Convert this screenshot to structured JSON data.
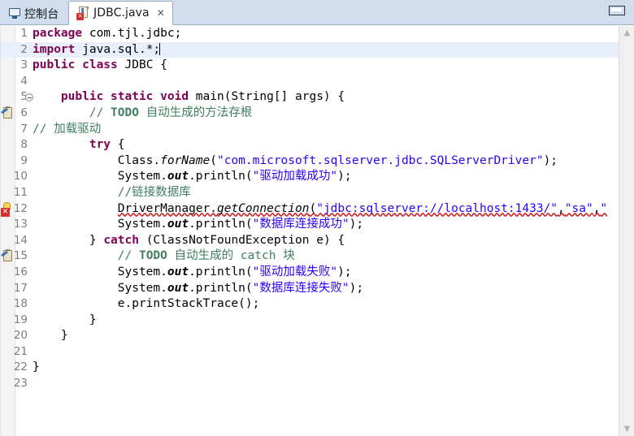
{
  "window": {
    "minimize_label": "Minimize"
  },
  "tabs": [
    {
      "label": "控制台",
      "icon": "console-icon",
      "active": false,
      "closable": false
    },
    {
      "label": "JDBC.java",
      "icon": "java-file-error-icon",
      "active": true,
      "closable": true,
      "close_glyph": "✕"
    }
  ],
  "editor": {
    "language": "java",
    "current_line": 2,
    "total_lines": 23,
    "colors": {
      "keyword": "#7f0055",
      "string": "#2a00ff",
      "comment": "#3f7f5f",
      "error_underline": "#d10b0b",
      "current_line_bg": "#e8f0fb",
      "gutter_bg": "#f4f4f4",
      "tabbar_bg": "#cfdded",
      "background": "#ffffff"
    },
    "lines": [
      {
        "n": "1",
        "marker": "none",
        "fold": false,
        "html": "<span class=\"kw\">package</span> <span class=\"plain\">com.tjl.jdbc;</span>",
        "plain": "package com.tjl.jdbc;"
      },
      {
        "n": "2",
        "marker": "change",
        "fold": false,
        "html": "<span class=\"kw\">import</span> <span class=\"plain\">java.sql.*;</span><span class=\"caret\"></span>",
        "plain": "import java.sql.*;"
      },
      {
        "n": "3",
        "marker": "none",
        "fold": false,
        "html": "<span class=\"kw\">public class</span> <span class=\"plain\">JDBC {</span>",
        "plain": "public class JDBC {"
      },
      {
        "n": "4",
        "marker": "none",
        "fold": false,
        "html": "",
        "plain": ""
      },
      {
        "n": "5",
        "marker": "none",
        "fold": true,
        "html": "<span class=\"plain\">    </span><span class=\"kw\">public static void</span> <span class=\"plain\">main(String[] args) {</span>",
        "plain": "    public static void main(String[] args) {"
      },
      {
        "n": "6",
        "marker": "todo",
        "fold": false,
        "html": "<span class=\"plain\">        </span><span class=\"cmt\">// </span><span class=\"todo\">TODO</span><span class=\"cmt\"> 自动生成的方法存根</span>",
        "plain": "        // TODO 自动生成的方法存根"
      },
      {
        "n": "7",
        "marker": "none",
        "fold": false,
        "html": "<span class=\"cmt\">// 加载驱动</span>",
        "plain": "// 加载驱动"
      },
      {
        "n": "8",
        "marker": "none",
        "fold": false,
        "html": "<span class=\"plain\">        </span><span class=\"kw\">try</span> <span class=\"plain\">{</span>",
        "plain": "        try {"
      },
      {
        "n": "9",
        "marker": "none",
        "fold": false,
        "html": "<span class=\"plain\">            Class.</span><span class=\"fld\">forName</span><span class=\"plain\">(</span><span class=\"str\">\"com.microsoft.sqlserver.jdbc.SQLServerDriver\"</span><span class=\"plain\">);</span>",
        "plain": "            Class.forName(\"com.microsoft.sqlserver.jdbc.SQLServerDriver\");"
      },
      {
        "n": "10",
        "marker": "none",
        "fold": false,
        "html": "<span class=\"plain\">            System.</span><span class=\"stat\">out</span><span class=\"plain\">.println(</span><span class=\"str\">\"驱动加载成功\"</span><span class=\"plain\">);</span>",
        "plain": "            System.out.println(\"驱动加载成功\");"
      },
      {
        "n": "11",
        "marker": "none",
        "fold": false,
        "html": "<span class=\"plain\">            </span><span class=\"cmt\">//链接数据库</span>",
        "plain": "            //链接数据库"
      },
      {
        "n": "12",
        "marker": "error",
        "fold": false,
        "html": "<span class=\"plain\">            </span><span class=\"err-underline\"><span class=\"plain\">DriverManager.</span><span class=\"fld\">getConnection</span><span class=\"plain\">(</span><span class=\"str\">\"jdbc:sqlserver://localhost:1433/\"</span><span class=\"plain\">,</span><span class=\"str\">\"sa\"</span><span class=\"plain\">,</span><span class=\"str\">\"</span></span>",
        "plain": "            DriverManager.getConnection(\"jdbc:sqlserver://localhost:1433/\",\"sa\",\""
      },
      {
        "n": "13",
        "marker": "none",
        "fold": false,
        "html": "<span class=\"plain\">            System.</span><span class=\"stat\">out</span><span class=\"plain\">.println(</span><span class=\"str\">\"数据库连接成功\"</span><span class=\"plain\">);</span>",
        "plain": "            System.out.println(\"数据库连接成功\");"
      },
      {
        "n": "14",
        "marker": "none",
        "fold": false,
        "html": "<span class=\"plain\">        } </span><span class=\"kw\">catch</span> <span class=\"plain\">(ClassNotFoundException e) {</span>",
        "plain": "        } catch (ClassNotFoundException e) {"
      },
      {
        "n": "15",
        "marker": "todo",
        "fold": false,
        "html": "<span class=\"plain\">            </span><span class=\"cmt\">// </span><span class=\"todo\">TODO</span><span class=\"cmt\"> 自动生成的 catch 块</span>",
        "plain": "            // TODO 自动生成的 catch 块"
      },
      {
        "n": "16",
        "marker": "none",
        "fold": false,
        "html": "<span class=\"plain\">            System.</span><span class=\"stat\">out</span><span class=\"plain\">.println(</span><span class=\"str\">\"驱动加载失败\"</span><span class=\"plain\">);</span>",
        "plain": "            System.out.println(\"驱动加载失败\");"
      },
      {
        "n": "17",
        "marker": "none",
        "fold": false,
        "html": "<span class=\"plain\">            System.</span><span class=\"stat\">out</span><span class=\"plain\">.println(</span><span class=\"str\">\"数据库连接失败\"</span><span class=\"plain\">);</span>",
        "plain": "            System.out.println(\"数据库连接失败\");"
      },
      {
        "n": "18",
        "marker": "none",
        "fold": false,
        "html": "<span class=\"plain\">            e.printStackTrace();</span>",
        "plain": "            e.printStackTrace();"
      },
      {
        "n": "19",
        "marker": "none",
        "fold": false,
        "html": "<span class=\"plain\">        }</span>",
        "plain": "        }"
      },
      {
        "n": "20",
        "marker": "none",
        "fold": false,
        "html": "<span class=\"plain\">    }</span>",
        "plain": "    }"
      },
      {
        "n": "21",
        "marker": "none",
        "fold": false,
        "html": "",
        "plain": ""
      },
      {
        "n": "22",
        "marker": "none",
        "fold": false,
        "html": "<span class=\"plain\">}</span>",
        "plain": "}"
      },
      {
        "n": "23",
        "marker": "none",
        "fold": false,
        "html": "",
        "plain": ""
      }
    ]
  },
  "scrollbar": {
    "up_glyph": "▲",
    "down_glyph": "▼"
  }
}
